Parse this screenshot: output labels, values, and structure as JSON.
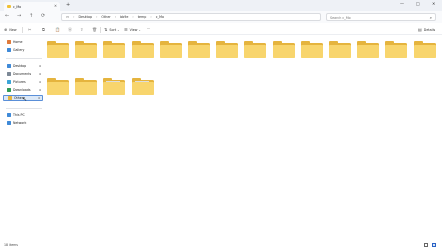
{
  "window": {
    "tab_title": "c_Mo",
    "new_tab_symbol": "+",
    "controls": {
      "minimize": "—",
      "maximize": "□",
      "close": "✕"
    }
  },
  "nav": {
    "back": "←",
    "forward": "→",
    "up": "↑",
    "refresh": "⟳",
    "monitor": "▭",
    "breadcrumbs": [
      "Desktop",
      "Other",
      "bb9e",
      "temp",
      "c_Mo"
    ],
    "search_placeholder": "Search c_Mo"
  },
  "commandbar": {
    "new_label": "New",
    "sort_label": "Sort",
    "view_label": "View",
    "more_label": "···",
    "details_label": "Details"
  },
  "sidebar": {
    "top_items": [
      {
        "label": "Home",
        "icon": "home-icon",
        "color": "#e07a3a"
      },
      {
        "label": "Gallery",
        "icon": "gallery-icon",
        "color": "#3f8ad8"
      }
    ],
    "pinned": [
      {
        "label": "Desktop",
        "icon": "desktop-icon",
        "color": "#3f8ad8"
      },
      {
        "label": "Documents",
        "icon": "documents-icon",
        "color": "#7c8896"
      },
      {
        "label": "Pictures",
        "icon": "pictures-icon",
        "color": "#3aa5d8"
      },
      {
        "label": "Downloads",
        "icon": "downloads-icon",
        "color": "#2f9b57"
      },
      {
        "label": "Other",
        "icon": "folder-icon",
        "color": "#e5b43e"
      }
    ],
    "bottom_items": [
      {
        "label": "This PC",
        "icon": "this-pc-icon",
        "color": "#3f8ad8"
      },
      {
        "label": "Network",
        "icon": "network-icon",
        "color": "#3f8ad8"
      }
    ],
    "pin_symbol": "✱"
  },
  "content": {
    "folders": [
      {
        "kind": "plain"
      },
      {
        "kind": "plain"
      },
      {
        "kind": "plain"
      },
      {
        "kind": "plain"
      },
      {
        "kind": "plain"
      },
      {
        "kind": "plain"
      },
      {
        "kind": "plain"
      },
      {
        "kind": "plain"
      },
      {
        "kind": "plain"
      },
      {
        "kind": "plain"
      },
      {
        "kind": "plain"
      },
      {
        "kind": "plain"
      },
      {
        "kind": "plain"
      },
      {
        "kind": "plain"
      },
      {
        "kind": "plain"
      },
      {
        "kind": "plain"
      },
      {
        "kind": "docs"
      },
      {
        "kind": "docs"
      }
    ]
  },
  "status": {
    "items_text": "18 items"
  },
  "colors": {
    "accent": "#2a62c6",
    "folder_front": "#f8d56d",
    "folder_back": "#e5b43e"
  }
}
